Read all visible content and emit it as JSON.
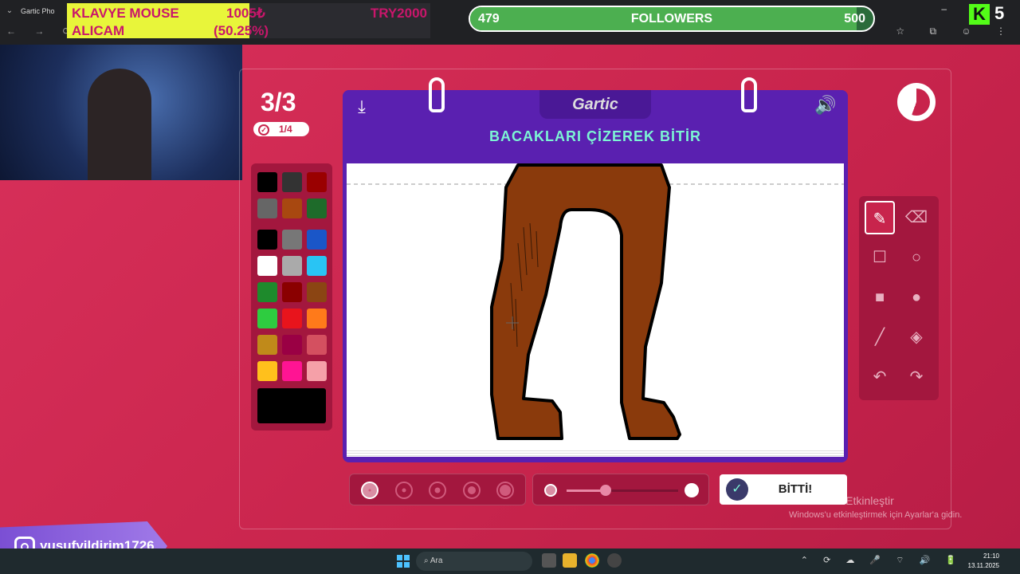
{
  "browser": {
    "tab_title": "Gartic Pho",
    "right_icons": "☆ ⧉ ☺ ⋮"
  },
  "stream": {
    "donation_goal": {
      "title": "KLAVYE MOUSE",
      "subtitle": "ALICAM",
      "current": "1005₺",
      "percent_text": "(50.25%)",
      "percent": 50.25,
      "target": "TRY2000",
      "fill_color": "#e8f53a"
    },
    "followers": {
      "current": "479",
      "label": "FOLLOWERS",
      "target": "500",
      "progress": 0.958
    },
    "kick": {
      "logo_letter": "K",
      "count": "5"
    },
    "instagram": {
      "handle": "yusufyildirim1726",
      "icon": "instagram-icon"
    }
  },
  "game": {
    "round": "3/3",
    "turn": "1/4",
    "task": "BACAKLARI ÇİZEREK BİTİR",
    "logo": "Gartic",
    "done_label": "BİTTİ!",
    "palette": [
      "#000000",
      "#333333",
      "#9a0000",
      "#666666",
      "#a84810",
      "#1e6b2a",
      "#000000",
      "#777777",
      "#1a56c8",
      "#ffffff",
      "#aaaaaa",
      "#29c4f4",
      "#1e8a2c",
      "#8a0000",
      "#8b4513",
      "#2ecc40",
      "#e8141c",
      "#ff7a1a",
      "#c08a1a",
      "#9a0044",
      "#d45060",
      "#ffc01c",
      "#ff1493",
      "#f5a0a8"
    ],
    "current_color": "#000000",
    "drawing_color": "#8a3a0c",
    "tools": [
      {
        "name": "pencil-icon",
        "glyph": "✎",
        "active": true
      },
      {
        "name": "eraser-icon",
        "glyph": "⌫",
        "active": false
      },
      {
        "name": "rectangle-outline-icon",
        "glyph": "☐",
        "active": false
      },
      {
        "name": "circle-outline-icon",
        "glyph": "○",
        "active": false
      },
      {
        "name": "rectangle-filled-icon",
        "glyph": "■",
        "active": false
      },
      {
        "name": "circle-filled-icon",
        "glyph": "●",
        "active": false
      },
      {
        "name": "line-icon",
        "glyph": "╱",
        "active": false
      },
      {
        "name": "fill-bucket-icon",
        "glyph": "◈",
        "active": false
      },
      {
        "name": "undo-icon",
        "glyph": "↶",
        "active": false
      },
      {
        "name": "redo-icon",
        "glyph": "↷",
        "active": false
      }
    ],
    "thickness_selected": 0,
    "opacity": 0.35
  },
  "os": {
    "activation_title": "Windows'u Etkinleştir",
    "activation_sub": "Windows'u etkinleştirmek için Ayarlar'a gidin.",
    "search_placeholder": "Ara",
    "time": "21:10",
    "date": "13.11.2025"
  }
}
